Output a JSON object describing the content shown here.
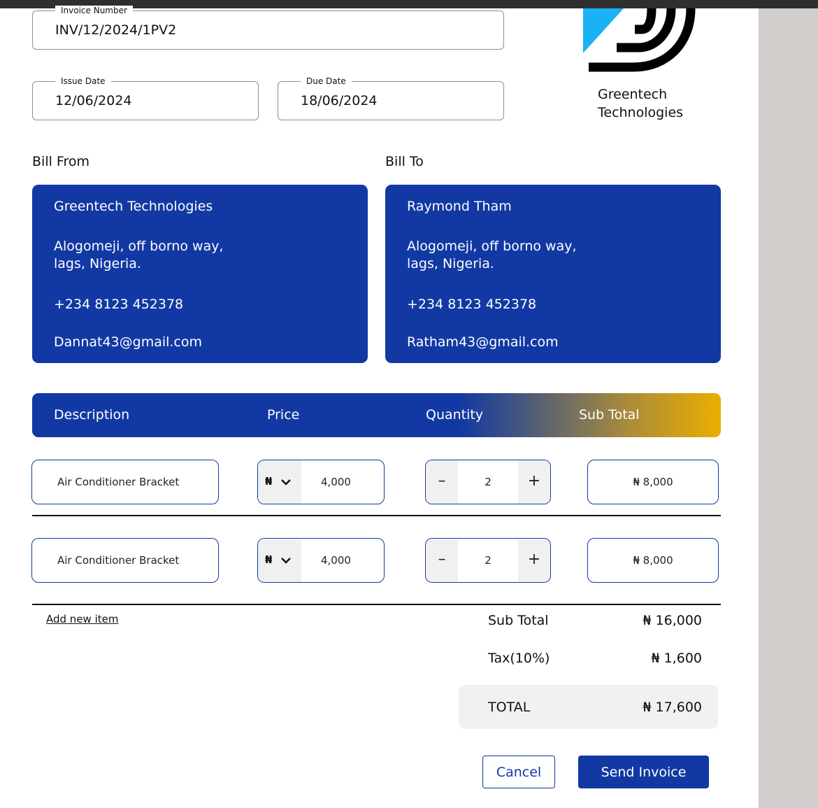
{
  "invoice": {
    "number_label": "Invoice Number",
    "number_value": "INV/12/2024/1PV2",
    "issue_date_label": "Issue Date",
    "issue_date_value": "12/06/2024",
    "due_date_label": "Due Date",
    "due_date_value": "18/06/2024"
  },
  "company": {
    "name_line1": "Greentech",
    "name_line2": "Technologies",
    "logo_icon": "greentech-logo-icon",
    "logo_colors": [
      "#1ab2f5",
      "#000000"
    ]
  },
  "bill_from": {
    "label": "Bill From",
    "name": "Greentech Technologies",
    "address_line1": "Alogomeji, off borno way,",
    "address_line2": "lags, Nigeria.",
    "phone": "+234 8123 452378",
    "email": "Dannat43@gmail.com"
  },
  "bill_to": {
    "label": "Bill To",
    "name": "Raymond Tham",
    "address_line1": "Alogomeji, off borno way,",
    "address_line2": "lags, Nigeria.",
    "phone": "+234 8123 452378",
    "email": "Ratham43@gmail.com"
  },
  "table": {
    "headers": [
      "Description",
      "Price",
      "Quantity",
      "Sub Total"
    ],
    "rows": [
      {
        "description": "Air Conditioner Bracket",
        "currency": "₦",
        "price": "4,000",
        "quantity": "2",
        "subtotal": "₦ 8,000"
      },
      {
        "description": "Air Conditioner Bracket",
        "currency": "₦",
        "price": "4,000",
        "quantity": "2",
        "subtotal": "₦ 8,000"
      }
    ],
    "decrement_symbol": "–",
    "increment_symbol": "+",
    "add_item_label": "Add new item"
  },
  "summary": {
    "subtotal_label": "Sub Total",
    "subtotal_value": "₦ 16,000",
    "tax_label": "Tax(10%)",
    "tax_value": "₦ 1,600",
    "total_label": "TOTAL",
    "total_value": "₦ 17,600"
  },
  "actions": {
    "cancel_label": "Cancel",
    "send_label": "Send Invoice"
  },
  "colors": {
    "primary": "#1239a3",
    "accent_gold": "#ebae00",
    "side_panel": "#d1cdca"
  }
}
